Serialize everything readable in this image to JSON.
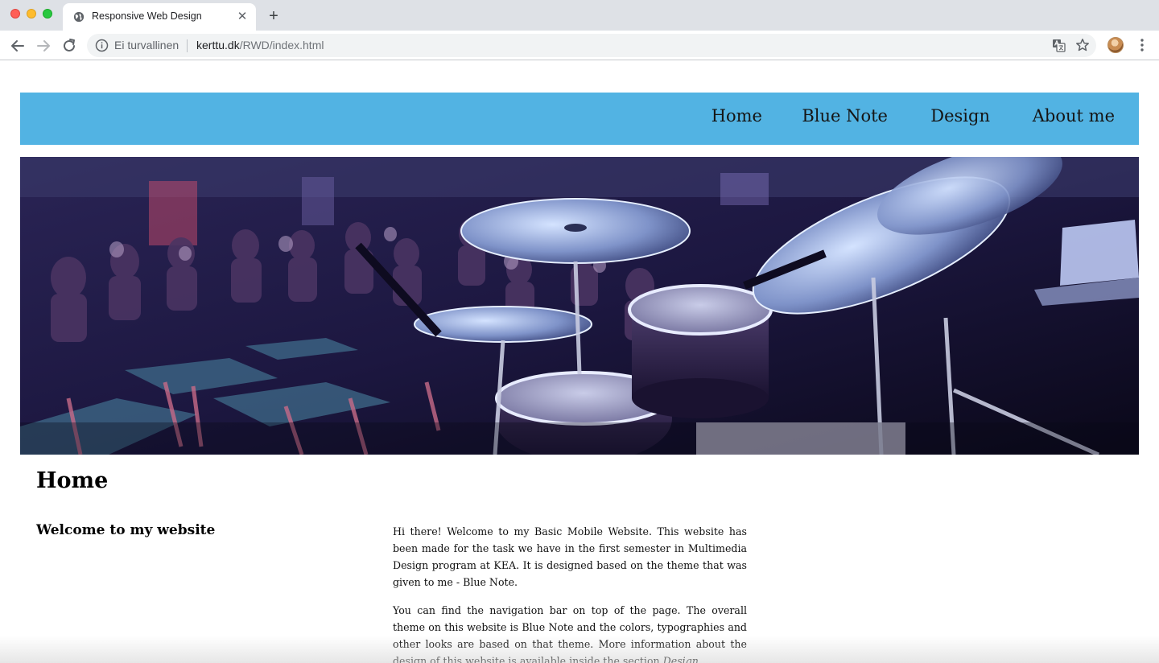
{
  "browser": {
    "tab_title": "Responsive Web Design",
    "tab_close": "✕",
    "new_tab": "+",
    "security_label": "Ei turvallinen",
    "url_host": "kerttu.dk",
    "url_path": "/RWD/index.html"
  },
  "site": {
    "nav": [
      "Home",
      "Blue Note",
      "Design",
      "About me"
    ],
    "nav_color": "#52b3e3",
    "page_title": "Home",
    "welcome_heading": "Welcome to my website",
    "paragraph_1": "Hi there! Welcome to my Basic Mobile Website. This website has been made for the task we have in the first semester in Multimedia Design program at KEA. It is designed based on the theme that was given to me - Blue Note.",
    "paragraph_2_main": "You can find the navigation bar on top of the page. The overall theme on this website is Blue Note and the colors, typographies and other looks are based on that theme. More information about the design of this website is available inside the section ",
    "paragraph_2_link": "Design",
    "paragraph_2_end": "."
  }
}
